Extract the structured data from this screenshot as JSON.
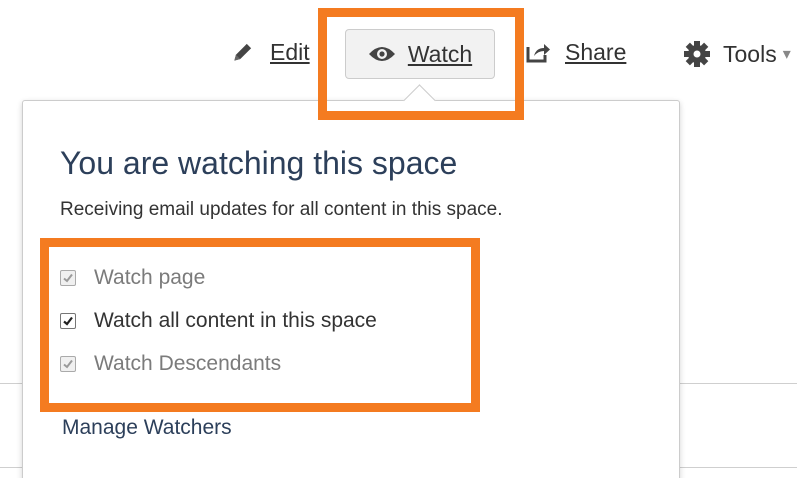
{
  "toolbar": {
    "edit_label": "Edit",
    "watch_label": "Watch",
    "share_label": "Share",
    "tools_label": "Tools",
    "icons": {
      "edit": "pencil-icon",
      "watch": "eye-icon",
      "share": "share-icon",
      "tools": "gear-icon"
    }
  },
  "watch_panel": {
    "title": "You are watching this space",
    "description": "Receiving email updates for all content in this space.",
    "options": [
      {
        "label": "Watch page",
        "checked": true,
        "disabled": true
      },
      {
        "label": "Watch all content in this space",
        "checked": true,
        "disabled": false
      },
      {
        "label": "Watch Descendants",
        "checked": true,
        "disabled": true
      }
    ],
    "manage_link": "Manage Watchers"
  },
  "colors": {
    "highlight": "#f47b20",
    "title_text": "#2c3f5a",
    "body_text": "#333333",
    "disabled_text": "#7b7b7b",
    "button_bg": "#f2f2f2"
  }
}
